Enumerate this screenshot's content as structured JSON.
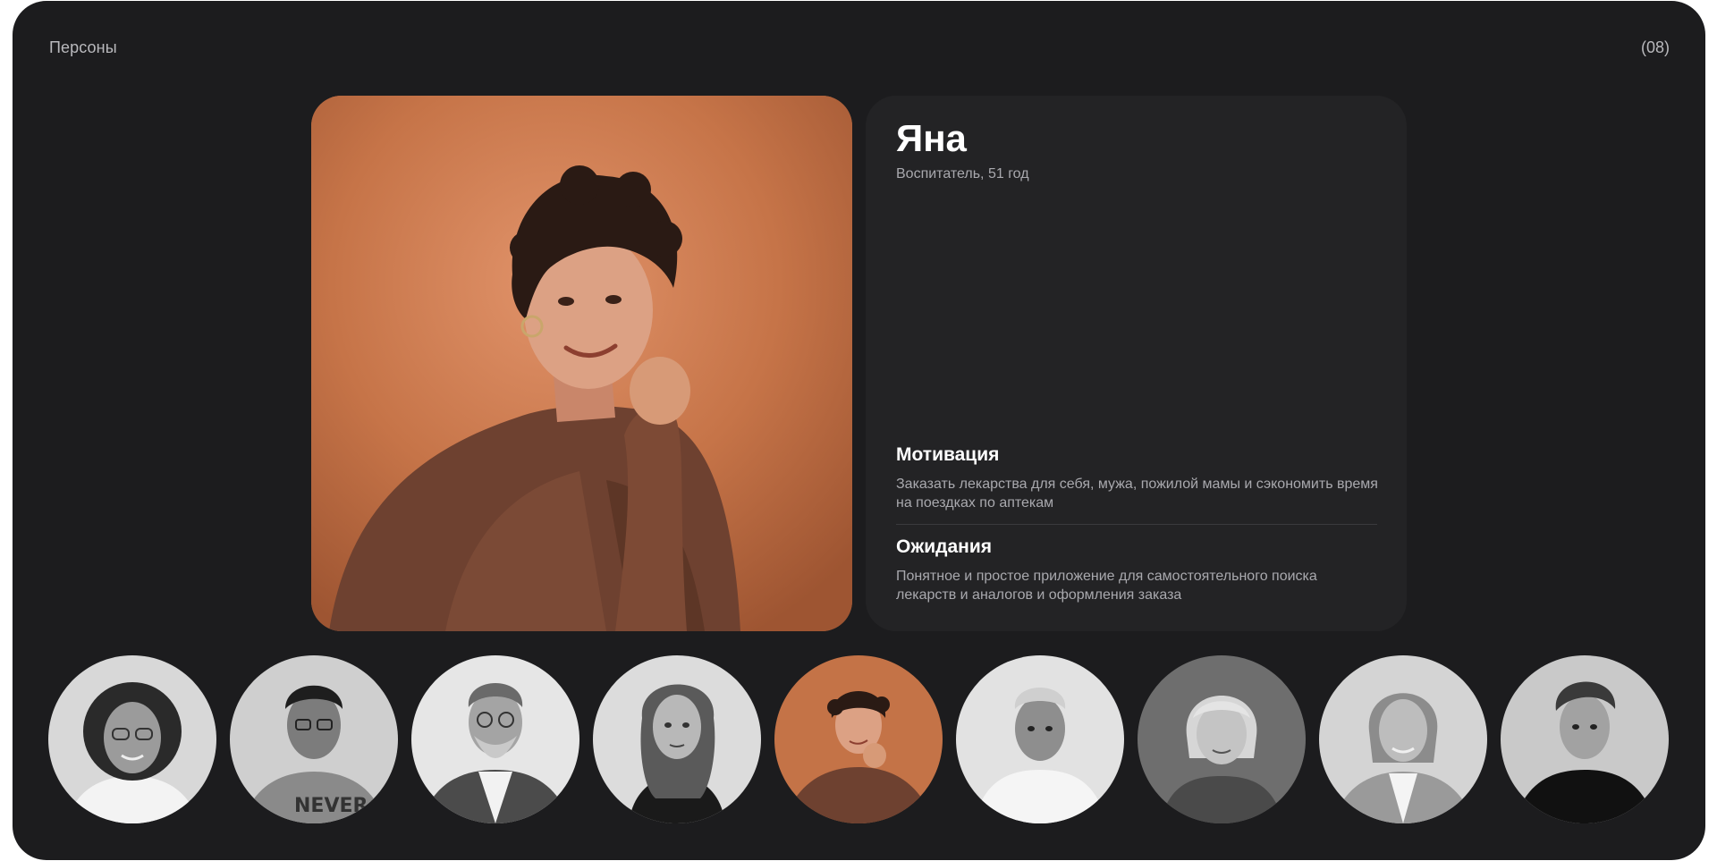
{
  "header": {
    "section_title": "Персоны",
    "page_counter": "(08)"
  },
  "persona": {
    "name": "Яна",
    "subtitle": "Воспитатель, 51 год",
    "photo": "woman-curly-hair-portrait",
    "motivation": {
      "heading": "Мотивация",
      "text": "Заказать лекарства для себя, мужа, пожилой мамы и сэкономить время на поездках по аптекам"
    },
    "expectations": {
      "heading": "Ожидания",
      "text": "Понятное и простое приложение для самостоятельного поиска лекарств и аналогов и оформления заказа"
    }
  },
  "avatars": [
    {
      "name": "avatar-woman-curly-glasses",
      "selected": false
    },
    {
      "name": "avatar-man-glasses-never-shirt",
      "selected": false
    },
    {
      "name": "avatar-old-man-beard-vest",
      "selected": false
    },
    {
      "name": "avatar-young-woman-wavy-hair",
      "selected": false
    },
    {
      "name": "avatar-yana",
      "selected": true
    },
    {
      "name": "avatar-young-man-hoodie",
      "selected": false
    },
    {
      "name": "avatar-blonde-woman-bob",
      "selected": false
    },
    {
      "name": "avatar-older-woman-blazer",
      "selected": false
    },
    {
      "name": "avatar-young-man-black-shirt",
      "selected": false
    }
  ],
  "colors": {
    "background": "#1c1c1e",
    "card": "#232325",
    "accent_orange": "#c47347",
    "text_primary": "#ffffff",
    "text_secondary": "#a9a9ae"
  }
}
